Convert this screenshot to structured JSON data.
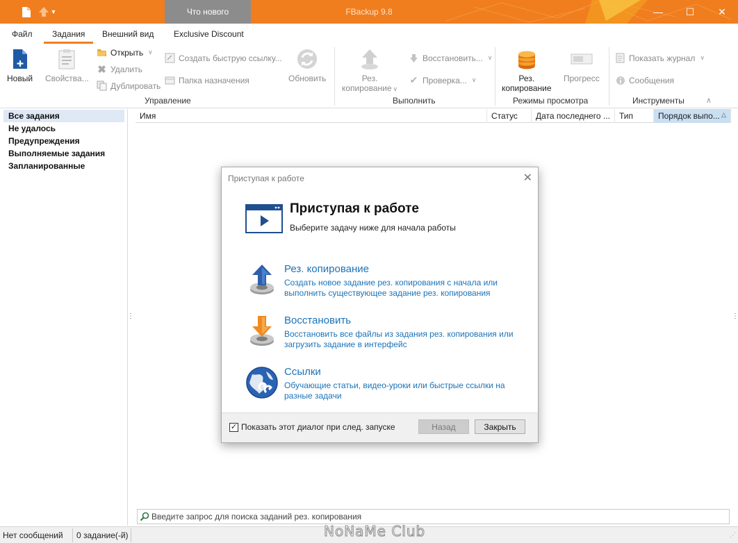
{
  "titlebar": {
    "app_title": "FBackup 9.8",
    "whats_new": "Что нового",
    "minimize": "—",
    "maximize": "☐",
    "close": "✕"
  },
  "tabs": [
    "Файл",
    "Задания",
    "Внешний вид",
    "Exclusive Discount"
  ],
  "ribbon": {
    "new": "Новый",
    "properties": "Свойства...",
    "open": "Открыть",
    "delete": "Удалить",
    "duplicate": "Дублировать",
    "quick_link": "Создать быструю ссылку...",
    "dest_folder": "Папка назначения",
    "refresh": "Обновить",
    "group_manage": "Управление",
    "backup_1": "Рез.",
    "backup_2": "копирование",
    "restore": "Восстановить...",
    "check": "Проверка...",
    "group_execute": "Выполнить",
    "view_backup_1": "Рез.",
    "view_backup_2": "копирование",
    "progress": "Прогресс",
    "group_view_modes": "Режимы просмотра",
    "show_log": "Показать журнал",
    "messages": "Сообщения",
    "group_tools": "Инструменты"
  },
  "nav": {
    "items": [
      "Все задания",
      "Не удалось",
      "Предупреждения",
      "Выполняемые задания",
      "Запланированные"
    ]
  },
  "table": {
    "columns": [
      "Имя",
      "Статус",
      "Дата последнего ...",
      "Тип",
      "Порядок выпо..."
    ]
  },
  "search": {
    "placeholder": "Введите запрос для поиска заданий рез. копирования"
  },
  "status": {
    "messages": "Нет сообщений",
    "count": "0 задание(-й)",
    "watermark": "NoNaMe Club"
  },
  "dialog": {
    "title": "Приступая к работе",
    "heading": "Приступая к работе",
    "subtitle": "Выберите задачу ниже для начала работы",
    "options": [
      {
        "title": "Рез. копирование",
        "desc": "Создать новое задание рез. копирования с начала или выполнить существующее задание рез. копирования"
      },
      {
        "title": "Восстановить",
        "desc": "Восстановить все файлы из задания рез. копирования или загрузить задание в интерфейс"
      },
      {
        "title": "Ссылки",
        "desc": "Обучающие статьи, видео-уроки или быстрые ссылки на разные задачи"
      }
    ],
    "show_checkbox": "Показать этот диалог при след. запуске",
    "back": "Назад",
    "close": "Закрыть"
  },
  "colors": {
    "accent": "#f07e1f",
    "link": "#1a73b8"
  }
}
